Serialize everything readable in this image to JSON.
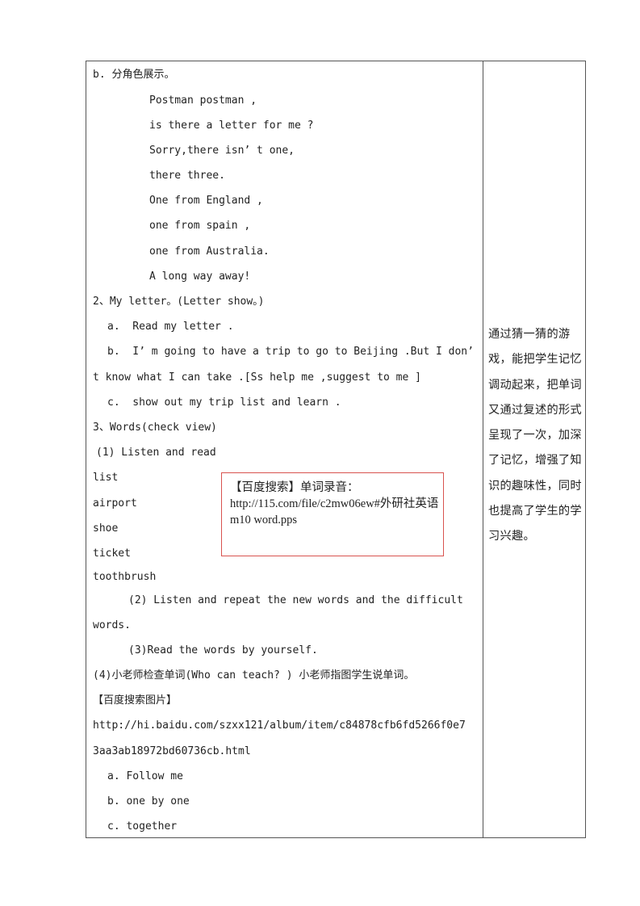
{
  "left_column": {
    "section_b_heading": "b. 分角色展示。",
    "chant_lines": [
      "Postman postman ,",
      "is there a letter for me ?",
      "Sorry,there isn’ t one,",
      "there three.",
      "One from England ,",
      "one from spain ,",
      "one from Australia.",
      "A long way away!"
    ],
    "section_2_heading": "2、My letter。(Letter show。)",
    "section_2_items": [
      "a.  Read my letter .",
      "b.  I’ m going to have a trip to go to Beijing .But I don’",
      "t know what I can take .[Ss help me ,suggest to me ]",
      "c.  show out my trip list and learn ."
    ],
    "section_3_heading": "3、Words(check view)",
    "step_1": "(1) Listen and read",
    "words": [
      "list",
      "airport",
      "shoe",
      "ticket",
      "toothbrush"
    ],
    "step_2_line1": "(2) Listen and repeat the new words and the difficult",
    "step_2_line2": "words.",
    "step_3": "(3)Read the words by yourself.",
    "step_4": "(4)小老师检查单词(Who can teach? ) 小老师指图学生说单词。",
    "image_search_label": "【百度搜索图片】",
    "image_url_line1": "http://hi.baidu.com/szxx121/album/item/c84878cfb6fd5266f0e7",
    "image_url_line2": "3aa3ab18972bd60736cb.html",
    "practice_items": [
      "a. Follow me",
      "b. one by one",
      "c. together"
    ]
  },
  "callout_box": {
    "text": "【百度搜索】单词录音：http://115.com/file/c2mw06ew#外研社英语 m10   word.pps",
    "border_color": "#d9534f"
  },
  "right_column": {
    "note": "通过猜一猜的游戏，能把学生记忆调动起来，把单词又通过复述的形式呈现了一次，加深了记忆，增强了知识的趣味性，同时也提高了学生的学习兴趣。"
  }
}
